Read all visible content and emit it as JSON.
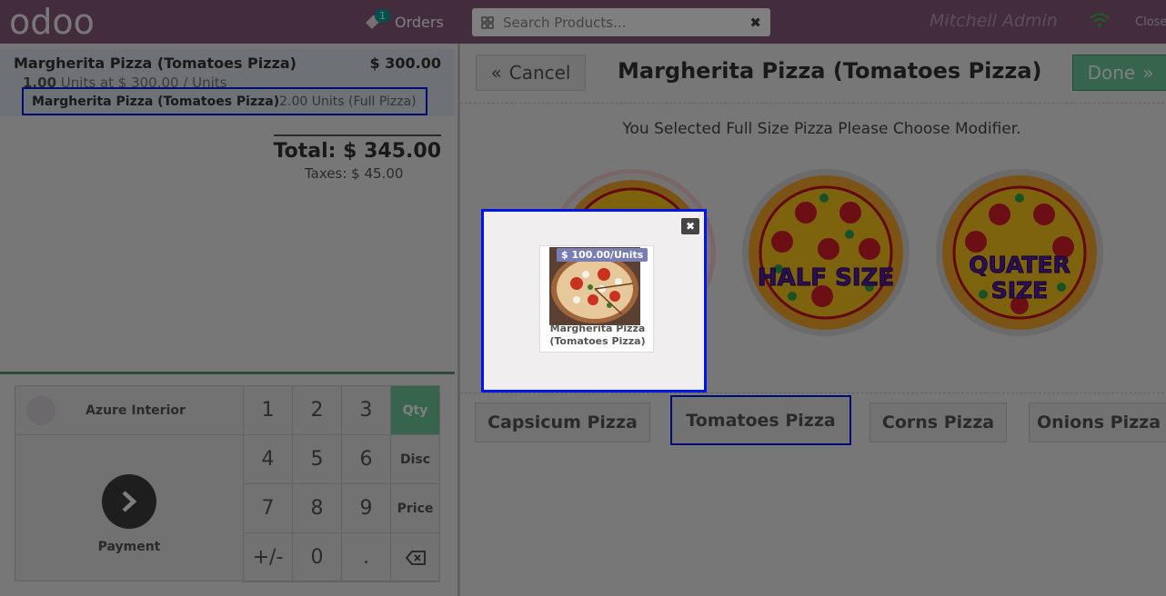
{
  "header": {
    "logo_text": "odoo",
    "orders_label": "Orders",
    "orders_count": "1",
    "search_placeholder": "Search Products...",
    "user_name": "Mitchell Admin",
    "close_label": "Close"
  },
  "order": {
    "line_name": "Margherita Pizza (Tomatoes Pizza)",
    "line_price": "$ 300.00",
    "line_qty": "1.00",
    "line_info": "Units at $ 300.00 / Units",
    "modifier_name": "Margherita Pizza (Tomatoes Pizza)",
    "modifier_qty": "2.00 Units (Full Pizza)",
    "total": "Total: $ 345.00",
    "taxes": "Taxes: $ 45.00"
  },
  "pad": {
    "customer": "Azure Interior",
    "payment": "Payment",
    "keys": [
      "1",
      "2",
      "3",
      "Qty",
      "4",
      "5",
      "6",
      "Disc",
      "7",
      "8",
      "9",
      "Price",
      "+/-",
      "0",
      ".",
      "⌫"
    ]
  },
  "right": {
    "cancel": "Cancel",
    "title": "Margherita Pizza (Tomatoes Pizza)",
    "done": "Done",
    "subtitle": "You Selected Full Size Pizza Please Choose Modifier.",
    "half_size": "HALF SIZE",
    "quarter_size_1": "QUATER",
    "quarter_size_2": "SIZE",
    "modifiers": [
      "Capsicum Pizza",
      "Tomatoes Pizza",
      "Corns Pizza",
      "Onions Pizza"
    ]
  },
  "popup": {
    "price_badge": "$ 100.00/Units",
    "product_name_1": "Margherita Pizza",
    "product_name_2": "(Tomatoes Pizza)"
  },
  "colors": {
    "brand": "#875a7b",
    "accent_green": "#6ec89b",
    "highlight_blue": "#0016e8"
  }
}
